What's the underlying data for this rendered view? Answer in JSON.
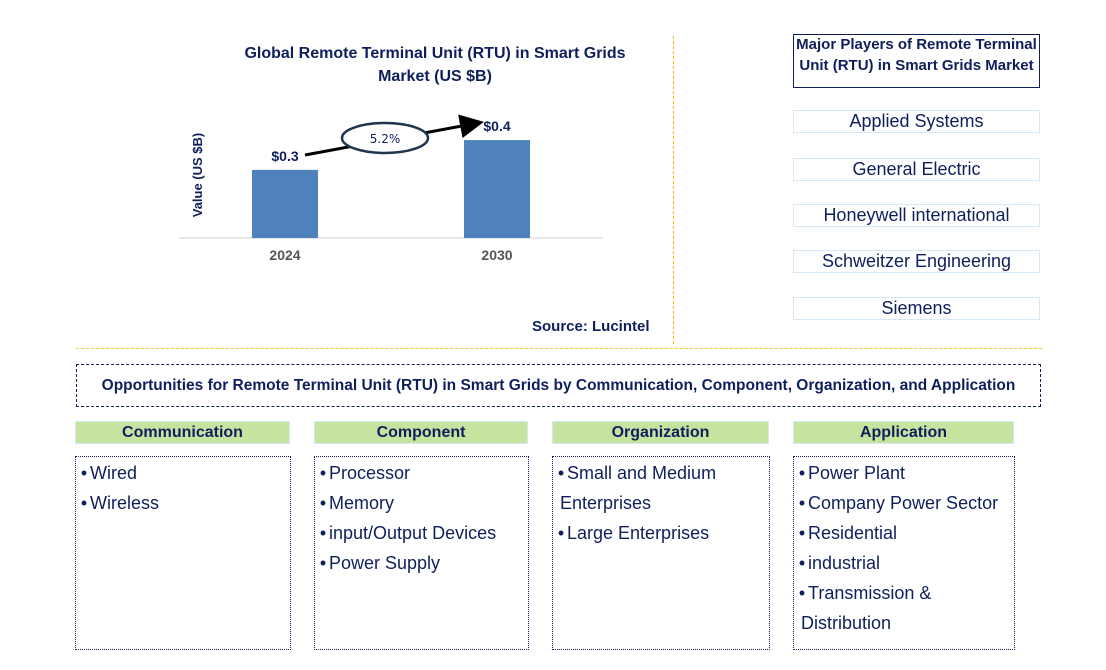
{
  "chart_data": {
    "type": "bar",
    "title": "Global Remote Terminal Unit (RTU) in Smart Grids Market (US $B)",
    "categories": [
      "2024",
      "2030"
    ],
    "values": [
      0.3,
      0.4
    ],
    "data_labels": [
      "$0.3",
      "$0.4"
    ],
    "xlabel": "",
    "ylabel": "Value (US $B)",
    "ylim": [
      0,
      0.5
    ],
    "grid": false,
    "annotation": {
      "label": "5.2%",
      "meaning": "CAGR",
      "from": "2024",
      "to": "2030"
    },
    "bar_color": "#4f81bd"
  },
  "source": "Source: Lucintel",
  "players": {
    "title": "Major Players of Remote Terminal Unit (RTU) in Smart Grids Market",
    "items": [
      "Applied Systems",
      "General Electric",
      "Honeywell international",
      "Schweitzer Engineering",
      "Siemens"
    ]
  },
  "opportunities": {
    "title": "Opportunities for Remote Terminal Unit (RTU) in Smart Grids by Communication, Component, Organization, and Application",
    "categories": [
      {
        "name": "Communication",
        "items": [
          "Wired",
          "Wireless"
        ]
      },
      {
        "name": "Component",
        "items": [
          "Processor",
          "Memory",
          "input/Output Devices",
          "Power Supply"
        ]
      },
      {
        "name": "Organization",
        "items": [
          "Small and Medium\nEnterprises",
          "Large Enterprises"
        ]
      },
      {
        "name": "Application",
        "items": [
          "Power Plant",
          "Company Power Sector",
          "Residential",
          "industrial",
          "Transmission &\nDistribution"
        ]
      }
    ]
  },
  "colors": {
    "text": "#0f1f5c",
    "bar": "#4f81bd",
    "header_fill": "#c6e3a0",
    "divider": "#f5b800"
  }
}
